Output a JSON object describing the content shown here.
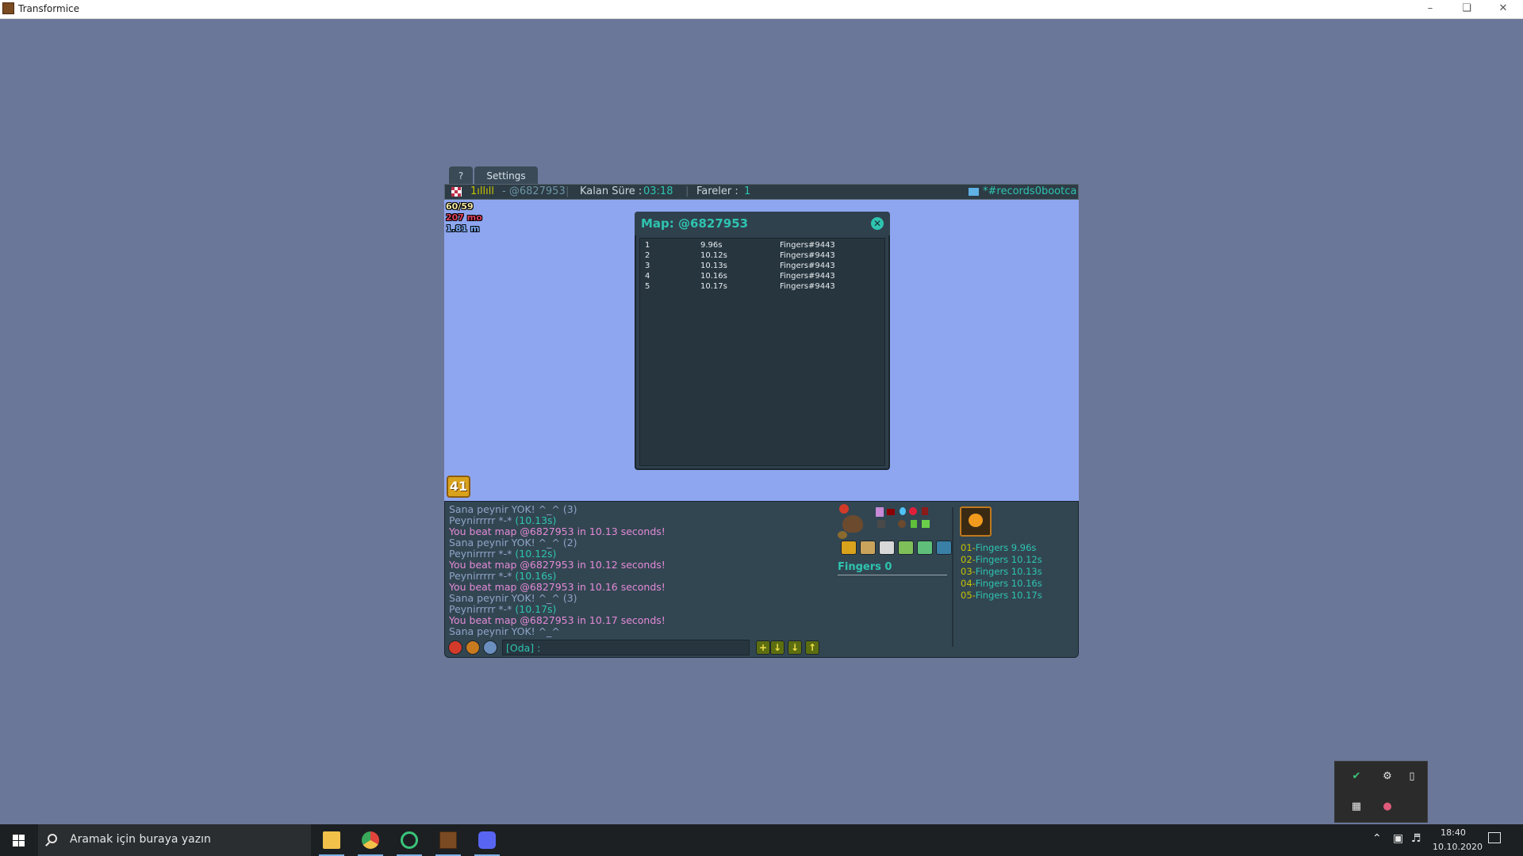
{
  "window": {
    "title": "Transformice"
  },
  "tabs": {
    "help": "?",
    "settings": "Settings"
  },
  "topbar": {
    "player_name": "1ıllıll",
    "map_code": " - @6827953",
    "sep": "|",
    "time_label": "Kalan Süre :",
    "time_value": "03:18",
    "mice_label": "Fareler :",
    "mice_value": "1",
    "room": "*#records0bootca"
  },
  "hud": {
    "fps": "60/59",
    "ms": "207 mo",
    "m": "1.81 m"
  },
  "level": "41",
  "popup": {
    "title": "Map: @6827953",
    "close": "✕",
    "records": [
      {
        "rank": "1",
        "time": "9.96s",
        "player": "Fingers#9443"
      },
      {
        "rank": "2",
        "time": "10.12s",
        "player": "Fingers#9443"
      },
      {
        "rank": "3",
        "time": "10.13s",
        "player": "Fingers#9443"
      },
      {
        "rank": "4",
        "time": "10.16s",
        "player": "Fingers#9443"
      },
      {
        "rank": "5",
        "time": "10.17s",
        "player": "Fingers#9443"
      }
    ]
  },
  "chat": {
    "lines": [
      {
        "text": "Sana peynir YOK! ^_^ (3)",
        "extra": ""
      },
      {
        "text": "Peynirrrrr *-* ",
        "extra": "(10.13s)"
      },
      {
        "text": "You beat map @6827953 in 10.13 seconds!",
        "extra": ""
      },
      {
        "text": "Sana peynir YOK! ^_^ (2)",
        "extra": ""
      },
      {
        "text": "Peynirrrrr *-* ",
        "extra": "(10.12s)"
      },
      {
        "text": "You beat map @6827953 in 10.12 seconds!",
        "extra": ""
      },
      {
        "text": "Peynirrrrr *-* ",
        "extra": "(10.16s)"
      },
      {
        "text": "You beat map @6827953 in 10.16 seconds!",
        "extra": ""
      },
      {
        "text": "Sana peynir YOK! ^_^ (3)",
        "extra": ""
      },
      {
        "text": "Peynirrrrr *-* ",
        "extra": "(10.17s)"
      },
      {
        "text": "You beat map @6827953 in 10.17 seconds!",
        "extra": ""
      },
      {
        "text": "Sana peynir YOK! ^_^",
        "extra": ""
      }
    ],
    "input_value": "[Oda] :"
  },
  "player": {
    "name": "Fingers 0"
  },
  "ranking": [
    {
      "rank": "01-",
      "entry": "Fingers 9.96s"
    },
    {
      "rank": "02-",
      "entry": "Fingers 10.12s"
    },
    {
      "rank": "03-",
      "entry": "Fingers 10.13s"
    },
    {
      "rank": "04-",
      "entry": "Fingers 10.16s"
    },
    {
      "rank": "05-",
      "entry": "Fingers 10.17s"
    }
  ],
  "taskbar": {
    "search_placeholder": "Aramak için buraya yazın",
    "time": "18:40",
    "date": "10.10.2020"
  },
  "colors": {
    "accent": "#2ec4b0",
    "chat_highlight": "#e48ad6",
    "chat_normal": "#8fa4c8",
    "name_yellow": "#c6c300"
  }
}
